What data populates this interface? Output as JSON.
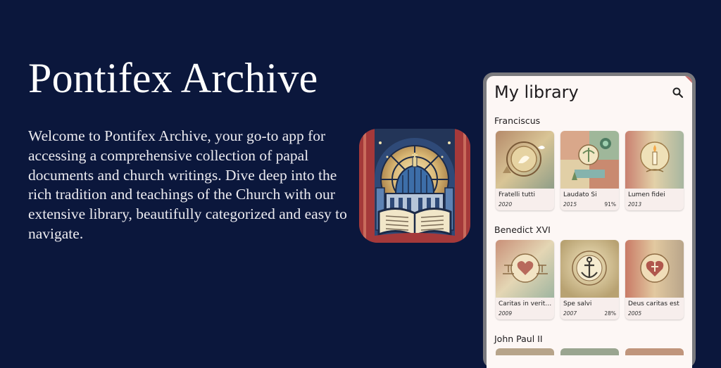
{
  "hero": {
    "title": "Pontifex Archive",
    "description": "Welcome to Pontifex Archive, your go-to app for accessing a comprehensive collection of papal documents and church writings. Dive deep into the rich tradition and teachings of the Church with our extensive library, beautifully categorized and easy to navigate."
  },
  "app_icon": {
    "name": "stained-glass-basilica-book-icon"
  },
  "library": {
    "title": "My library",
    "search_icon": "search-icon",
    "sections": [
      {
        "name": "Franciscus",
        "books": [
          {
            "title": "Fratelli tutti",
            "year": "2020",
            "progress": ""
          },
          {
            "title": "Laudato Si",
            "year": "2015",
            "progress": "91%"
          },
          {
            "title": "Lumen fidei",
            "year": "2013",
            "progress": ""
          }
        ]
      },
      {
        "name": "Benedict XVI",
        "books": [
          {
            "title": "Caritas in veritate",
            "year": "2009",
            "progress": ""
          },
          {
            "title": "Spe salvi",
            "year": "2007",
            "progress": "28%"
          },
          {
            "title": "Deus caritas est",
            "year": "2005",
            "progress": ""
          }
        ]
      },
      {
        "name": "John Paul II"
      }
    ]
  },
  "colors": {
    "background": "#0b173c",
    "screen": "#fdf7f5",
    "phone_frame": "#7a7a7e"
  }
}
